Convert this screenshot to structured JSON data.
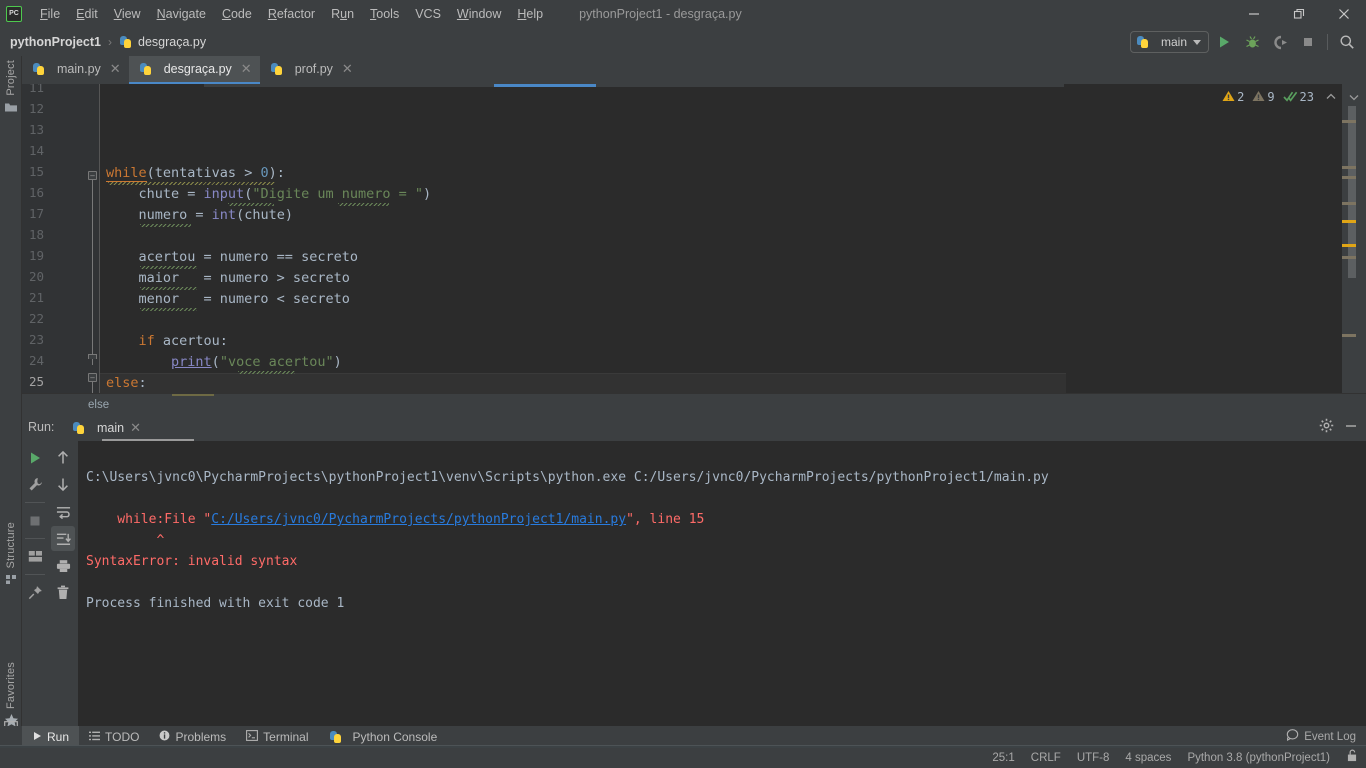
{
  "window": {
    "title": "pythonProject1 - desgraça.py",
    "logo_text": "PC",
    "logo_name": "pycharm-logo-icon",
    "controls": {
      "minimize": "minimize-icon",
      "restore": "restore-icon",
      "close": "close-icon"
    }
  },
  "menubar": {
    "items": [
      {
        "label": "File",
        "mnemonic": "F"
      },
      {
        "label": "Edit",
        "mnemonic": "E"
      },
      {
        "label": "View",
        "mnemonic": "V"
      },
      {
        "label": "Navigate",
        "mnemonic": "N"
      },
      {
        "label": "Code",
        "mnemonic": "C"
      },
      {
        "label": "Refactor",
        "mnemonic": "R"
      },
      {
        "label": "Run",
        "mnemonic": "u"
      },
      {
        "label": "Tools",
        "mnemonic": "T"
      },
      {
        "label": "VCS",
        "mnemonic": ""
      },
      {
        "label": "Window",
        "mnemonic": "W"
      },
      {
        "label": "Help",
        "mnemonic": "H"
      }
    ]
  },
  "navbar": {
    "breadcrumb": {
      "project": "pythonProject1",
      "separator": "›",
      "file": "desgraça.py"
    },
    "run_config": {
      "label": "main",
      "icon": "python-file-icon",
      "dropdown": "chevron-down-icon"
    },
    "buttons": [
      {
        "name": "run-button",
        "label": "Run",
        "icon": "play-icon",
        "color": "#59a869"
      },
      {
        "name": "debug-button",
        "label": "Debug",
        "icon": "bug-icon",
        "color": "#6ca35a"
      },
      {
        "name": "run-with-coverage-button",
        "label": "Run with Coverage",
        "icon": "coverage-icon",
        "color": "#8a8a8a"
      },
      {
        "name": "stop-button",
        "label": "Stop",
        "icon": "stop-square-icon",
        "color": "#8a8a8a"
      },
      {
        "name": "search-everywhere-button",
        "label": "Search Everywhere",
        "icon": "search-icon",
        "color": "#b9b9b9"
      }
    ]
  },
  "left_rail": {
    "items": [
      {
        "label": "Project",
        "icon": "folder-icon"
      },
      {
        "label": "Structure",
        "icon": "structure-icon"
      },
      {
        "label": "Favorites",
        "icon": "star-icon"
      }
    ],
    "bottom_icon": "layout-toggle-icon"
  },
  "editor_tabs": [
    {
      "label": "main.py",
      "icon": "python-file-icon",
      "active": false,
      "close": "close-icon"
    },
    {
      "label": "desgraça.py",
      "icon": "python-file-icon",
      "active": true,
      "close": "close-icon"
    },
    {
      "label": "prof.py",
      "icon": "python-file-icon",
      "active": false,
      "close": "close-icon"
    }
  ],
  "editor": {
    "first_visible_line": 11,
    "current_line": 25,
    "breadcrumb": "else",
    "inspections": {
      "warnings_count": "2",
      "weak_warnings_count": "9",
      "checks_count": "23",
      "warning_color": "#e0a516",
      "weak_warning_color": "#7d7461",
      "check_color": "#599e5e",
      "prev_icon": "chevron-up-icon",
      "next_icon": "chevron-down-icon"
    },
    "lines": [
      {
        "no": 11,
        "text": ""
      },
      {
        "no": 12,
        "text": ""
      },
      {
        "no": 13,
        "text": ""
      },
      {
        "no": 14,
        "text": ""
      },
      {
        "no": 15,
        "text": "while(tentativas > 0):"
      },
      {
        "no": 16,
        "text": "    chute = input(\"Digite um numero = \")"
      },
      {
        "no": 17,
        "text": "    numero = int(chute)"
      },
      {
        "no": 18,
        "text": ""
      },
      {
        "no": 19,
        "text": "    acertou = numero == secreto"
      },
      {
        "no": 20,
        "text": "    maior   = numero > secreto"
      },
      {
        "no": 21,
        "text": "    menor   = numero < secreto"
      },
      {
        "no": 22,
        "text": ""
      },
      {
        "no": 23,
        "text": "    if acertou:"
      },
      {
        "no": 24,
        "text": "        print(\"voce acertou\")"
      },
      {
        "no": 25,
        "text": "else:"
      }
    ]
  },
  "run_window": {
    "header_label": "Run:",
    "tab_label": "main",
    "tab_icon": "python-file-icon",
    "tab_close": "close-icon",
    "settings_icon": "gear-icon",
    "minimize_icon": "minimize-icon",
    "left_toolbar": [
      {
        "name": "rerun-button",
        "icon": "play-icon",
        "color": "#59a869"
      },
      {
        "name": "edit-configurations-button",
        "icon": "wrench-icon",
        "color": "#a0a0a0"
      },
      {
        "name": "stop-button",
        "icon": "stop-square-icon",
        "color": "#6e7072"
      },
      {
        "name": "layout-button",
        "icon": "layout-icon",
        "color": "#a0a0a0"
      },
      {
        "name": "pin-tab-button",
        "icon": "pin-icon",
        "color": "#a0a0a0"
      }
    ],
    "right_toolbar": [
      {
        "name": "up-stacktrace-button",
        "icon": "arrow-up-icon",
        "color": "#b0b0b0"
      },
      {
        "name": "down-stacktrace-button",
        "icon": "arrow-down-icon",
        "color": "#b0b0b0"
      },
      {
        "name": "soft-wrap-button",
        "icon": "soft-wrap-icon",
        "color": "#b0b0b0"
      },
      {
        "name": "scroll-to-end-button",
        "icon": "scroll-to-end-icon",
        "color": "#b0b0b0",
        "active": true
      },
      {
        "name": "print-button",
        "icon": "printer-icon",
        "color": "#b0b0b0"
      },
      {
        "name": "clear-all-button",
        "icon": "trash-icon",
        "color": "#b0b0b0"
      }
    ],
    "console": {
      "command_line": "C:\\Users\\jvnc0\\PycharmProjects\\pythonProject1\\venv\\Scripts\\python.exe C:/Users/jvnc0/PycharmProjects/pythonProject1/main.py",
      "trace_file_prefix": "  File \"",
      "trace_file_link": "C:/Users/jvnc0/PycharmProjects/pythonProject1/main.py",
      "trace_file_suffix": "\", line 15",
      "trace_code": "    while:",
      "trace_caret": "         ^",
      "error_line": "SyntaxError: invalid syntax",
      "exit_line": "Process finished with exit code 1"
    }
  },
  "bottom_bar": {
    "items": [
      {
        "label": "Run",
        "icon": "play-icon",
        "active": true
      },
      {
        "label": "TODO",
        "icon": "todo-list-icon",
        "active": false
      },
      {
        "label": "Problems",
        "icon": "problems-icon",
        "active": false
      },
      {
        "label": "Terminal",
        "icon": "terminal-icon",
        "active": false
      },
      {
        "label": "Python Console",
        "icon": "python-console-icon",
        "active": false
      }
    ],
    "event_log": {
      "label": "Event Log",
      "icon": "event-log-icon"
    }
  },
  "status_bar": {
    "caret_position": "25:1",
    "line_separator": "CRLF",
    "encoding": "UTF-8",
    "indent": "4 spaces",
    "interpreter": "Python 3.8 (pythonProject1)",
    "lock_icon": "unlocked-padlock-icon"
  },
  "taskbar": {
    "icon": "window-stack-icon"
  },
  "colors": {
    "chrome": "#3c3f41",
    "editor_bg": "#2b2b2b",
    "gutter_bg": "#313335",
    "accent_blue": "#4a88c7",
    "keyword": "#cc7832",
    "string": "#6a8759",
    "number": "#6897bb",
    "plain": "#a9b7c6",
    "builtin": "#8888c6",
    "error_red": "#ff6b68",
    "link_blue": "#287bde",
    "green_run": "#59a869"
  }
}
